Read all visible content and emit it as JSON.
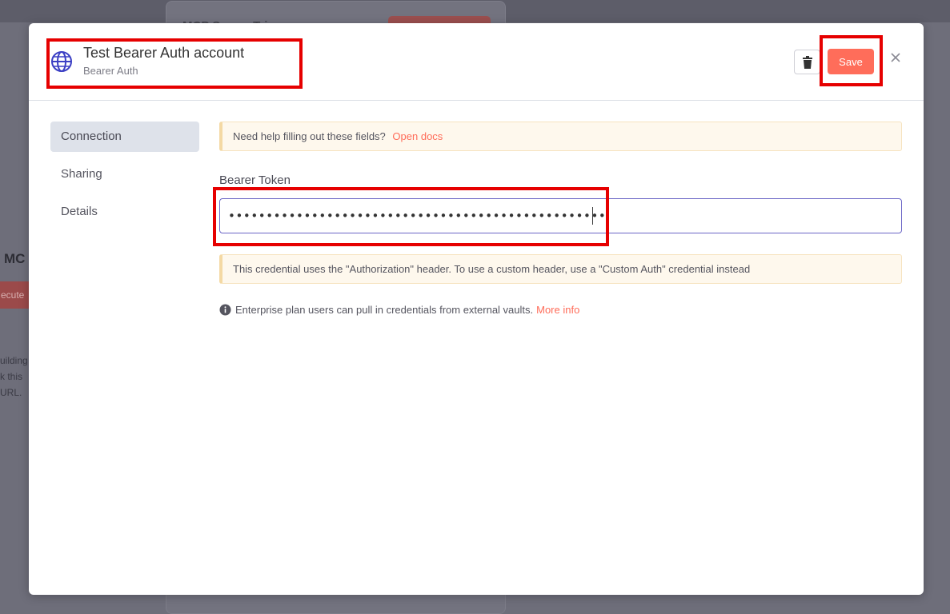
{
  "background": {
    "panel_title": "MCP Server Trig",
    "left_label": "MC",
    "left_button": "ecute",
    "left_text": [
      "uilding",
      "k this",
      "URL."
    ]
  },
  "modal": {
    "title": "Test Bearer Auth account",
    "subtitle": "Bearer Auth",
    "save_label": "Save",
    "delete_icon": "trash-icon",
    "close_icon": "close-icon",
    "type_icon": "globe-icon"
  },
  "sidebar": {
    "items": [
      {
        "label": "Connection",
        "active": true
      },
      {
        "label": "Sharing",
        "active": false
      },
      {
        "label": "Details",
        "active": false
      }
    ]
  },
  "content": {
    "help_text": "Need help filling out these fields?",
    "help_link": "Open docs",
    "token_label": "Bearer Token",
    "token_value": "••••••••••••••••••••••••••••••••••••••••••••••••••",
    "header_notice": "This credential uses the \"Authorization\" header. To use a custom header, use a \"Custom Auth\" credential instead",
    "enterprise_text": "Enterprise plan users can pull in credentials from external vaults.",
    "enterprise_link": "More info"
  },
  "colors": {
    "accent": "#ff6d5a",
    "input_border": "#6b66c6",
    "highlight": "#e60000",
    "notice_bg": "#fef8ed"
  }
}
